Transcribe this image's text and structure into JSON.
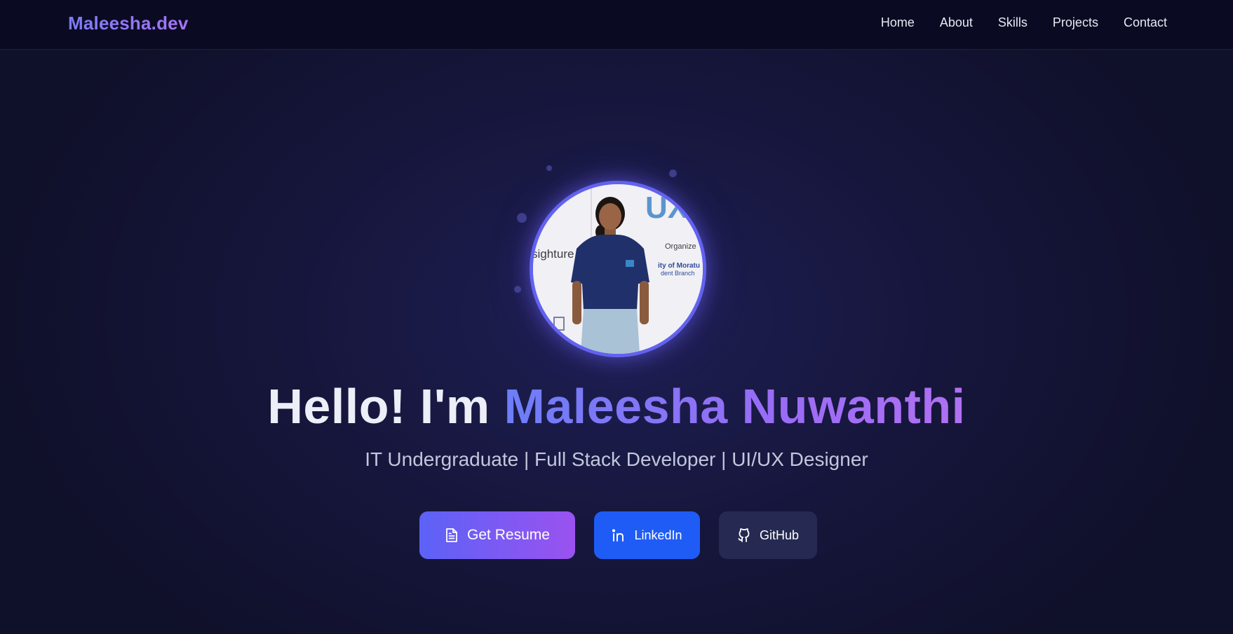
{
  "brand": "Maleesha.dev",
  "nav": {
    "items": [
      "Home",
      "About",
      "Skills",
      "Projects",
      "Contact"
    ]
  },
  "hero": {
    "greeting": "Hello! I'm ",
    "name": "Maleesha Nuwanthi",
    "subtitle": "IT Undergraduate | Full Stack Developer | UI/UX Designer",
    "profile_image_text": {
      "banner_word": "UX",
      "left_text": "sighture",
      "right_text": "Organize",
      "branch_line1": "ity of Moratu",
      "branch_line2": "dent Branch"
    }
  },
  "buttons": {
    "resume": {
      "label": "Get Resume",
      "icon": "document-icon"
    },
    "linkedin": {
      "label": "LinkedIn",
      "icon": "linkedin-icon"
    },
    "github": {
      "label": "GitHub",
      "icon": "github-icon"
    }
  },
  "colors": {
    "accent_start": "#6d7ef8",
    "accent_end": "#b070f2",
    "linkedin_blue": "#1f5cf5",
    "background": "#17173f"
  }
}
